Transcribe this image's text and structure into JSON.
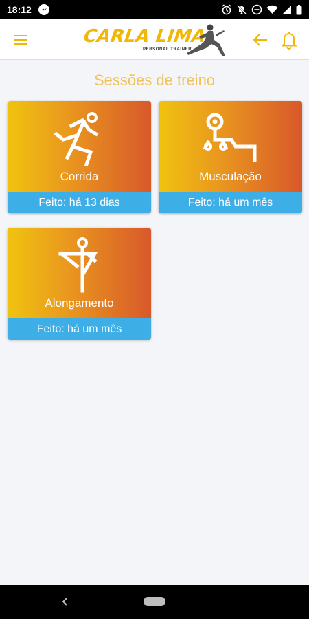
{
  "status_bar": {
    "time": "18:12",
    "icons": [
      "messenger-icon",
      "alarm-icon",
      "mute-icon",
      "dnd-icon",
      "wifi-icon",
      "signal-icon",
      "battery-icon"
    ]
  },
  "app_bar": {
    "logo_text": "CARLA LIMA",
    "logo_subtitle": "PERSONAL TRAINER",
    "icons": [
      "menu-icon",
      "back-arrow-icon",
      "bell-icon"
    ]
  },
  "section_title": "Sessões de treino",
  "sessions": [
    {
      "label": "Corrida",
      "footer": "Feito: há 13 dias",
      "icon": "running-icon"
    },
    {
      "label": "Musculação",
      "footer": "Feito: há um mês",
      "icon": "weightlifting-icon"
    },
    {
      "label": "Alongamento",
      "footer": "Feito: há um mês",
      "icon": "stretching-icon"
    }
  ],
  "colors": {
    "accent": "#f2b705",
    "card_gradient_start": "#f0c30f",
    "card_gradient_end": "#d8582a",
    "card_footer": "#3eaee6",
    "title": "#f0c45a"
  }
}
